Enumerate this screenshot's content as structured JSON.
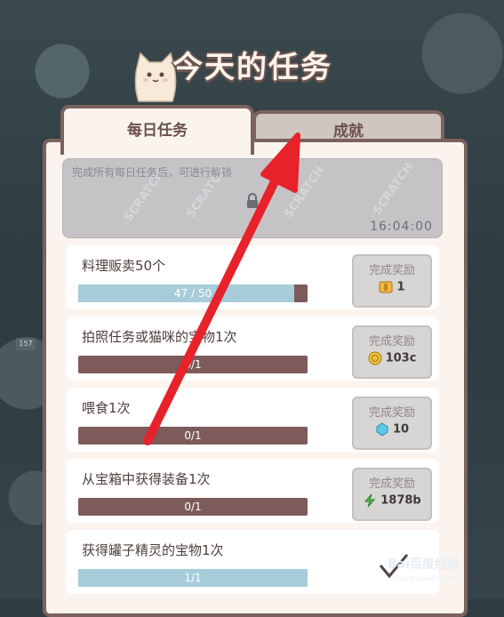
{
  "screen_title": "今天的任务",
  "tabs": {
    "daily": "每日任务",
    "achievement": "成就"
  },
  "lock": {
    "message": "完成所有每日任务后，可进行解锁",
    "scratch_text": "SCRATCH",
    "timer": "16:04:00"
  },
  "bg_sign": "157",
  "tasks": [
    {
      "name": "料理贩卖50个",
      "progress": "47 / 50",
      "fraction": 0.94,
      "reward_label": "完成奖励",
      "reward_icon": "ticket-icon",
      "reward_value": "1"
    },
    {
      "name": "拍照任务或猫咪的宝物1次",
      "progress": "0/1",
      "fraction": 0,
      "reward_label": "完成奖励",
      "reward_icon": "coin-icon",
      "reward_value": "103c"
    },
    {
      "name": "喂食1次",
      "progress": "0/1",
      "fraction": 0,
      "reward_label": "完成奖励",
      "reward_icon": "gem-icon",
      "reward_value": "10"
    },
    {
      "name": "从宝箱中获得装备1次",
      "progress": "0/1",
      "fraction": 0,
      "reward_label": "完成奖励",
      "reward_icon": "lightning-icon",
      "reward_value": "1878b"
    },
    {
      "name": "获得罐子精灵的宝物1次",
      "progress": "1/1",
      "fraction": 1,
      "completed": true
    }
  ],
  "watermark": {
    "text": "Bai百度经验",
    "sub": "jingyan.baidu.com"
  },
  "colors": {
    "panel_border": "#7b625e",
    "bar_bg": "#7d5b5a",
    "bar_fill": "#a6cdd9",
    "annotation_arrow": "#e8222a"
  }
}
